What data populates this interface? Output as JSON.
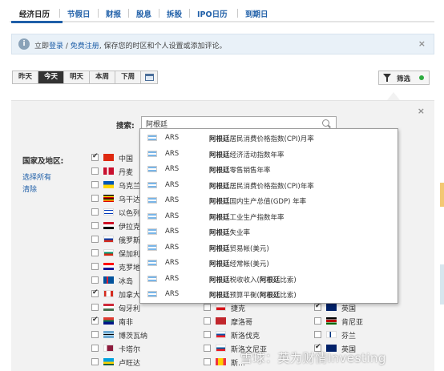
{
  "tabs": [
    {
      "label": "经济日历"
    },
    {
      "label": "节假日"
    },
    {
      "label": "财报"
    },
    {
      "label": "股息"
    },
    {
      "label": "拆股"
    },
    {
      "label": "IPO日历"
    },
    {
      "label": "到期日"
    }
  ],
  "banner": {
    "pre": "立即",
    "login": "登录",
    "sep": " / ",
    "register": "免费注册",
    "post": ", 保存您的时区和个人设置或添加评论。",
    "close": "×"
  },
  "date_buttons": [
    "昨天",
    "今天",
    "明天",
    "本周",
    "下周"
  ],
  "filter": {
    "label": "筛选"
  },
  "panel": {
    "close": "×",
    "search_label": "搜索:",
    "search_value": "阿根廷",
    "countries_label": "国家及地区:",
    "select_all": "选择所有",
    "clear": "清除"
  },
  "col1": [
    {
      "name": "中国",
      "checked": true
    },
    {
      "name": "丹麦",
      "checked": false
    },
    {
      "name": "乌克兰",
      "checked": false
    },
    {
      "name": "乌干达",
      "checked": false
    },
    {
      "name": "以色列",
      "checked": false
    },
    {
      "name": "伊拉克",
      "checked": false
    },
    {
      "name": "俄罗斯",
      "checked": false
    },
    {
      "name": "保加利",
      "checked": false
    },
    {
      "name": "克罗地",
      "checked": false
    },
    {
      "name": "冰岛",
      "checked": false
    },
    {
      "name": "加拿大",
      "checked": true
    },
    {
      "name": "匈牙利",
      "checked": false
    },
    {
      "name": "南非",
      "checked": true
    },
    {
      "name": "博茨瓦纳",
      "checked": false
    },
    {
      "name": "卡塔尔",
      "checked": false
    },
    {
      "name": "卢旺达",
      "checked": false
    }
  ],
  "col2": [
    {
      "name": "捷克",
      "checked": false
    },
    {
      "name": "摩洛哥",
      "checked": false
    },
    {
      "name": "斯洛伐克",
      "checked": false
    },
    {
      "name": "斯洛文尼亚",
      "checked": false
    },
    {
      "name": "斯…",
      "checked": false
    }
  ],
  "col3": [
    {
      "name": "英国",
      "checked": true
    },
    {
      "name": "肯尼亚",
      "checked": false
    },
    {
      "name": "芬兰",
      "checked": false
    },
    {
      "name": "英国",
      "checked": true
    }
  ],
  "dropdown": [
    {
      "code": "ARS",
      "bold": "阿根廷",
      "rest": "居民消费价格指数(CPI)月率",
      "bold2": "",
      "rest2": ""
    },
    {
      "code": "ARS",
      "bold": "阿根廷",
      "rest": "经济活动指数年率",
      "bold2": "",
      "rest2": ""
    },
    {
      "code": "ARS",
      "bold": "阿根廷",
      "rest": "零售销售年率",
      "bold2": "",
      "rest2": ""
    },
    {
      "code": "ARS",
      "bold": "阿根廷",
      "rest": "居民消费价格指数(CPI)年率",
      "bold2": "",
      "rest2": ""
    },
    {
      "code": "ARS",
      "bold": "阿根廷",
      "rest": "国内生产总值(GDP) 年率",
      "bold2": "",
      "rest2": ""
    },
    {
      "code": "ARS",
      "bold": "阿根廷",
      "rest": "工业生产指数年率",
      "bold2": "",
      "rest2": ""
    },
    {
      "code": "ARS",
      "bold": "阿根廷",
      "rest": "失业率",
      "bold2": "",
      "rest2": ""
    },
    {
      "code": "ARS",
      "bold": "阿根廷",
      "rest": "贸易帐(美元)",
      "bold2": "",
      "rest2": ""
    },
    {
      "code": "ARS",
      "bold": "阿根廷",
      "rest": "经常帐(美元)",
      "bold2": "",
      "rest2": ""
    },
    {
      "code": "ARS",
      "bold": "阿根廷",
      "rest": "税收收入(",
      "bold2": "阿根廷",
      "rest2": "比索)"
    },
    {
      "code": "ARS",
      "bold": "阿根廷",
      "rest": "预算平衡(",
      "bold2": "阿根廷",
      "rest2": "比索)"
    }
  ],
  "watermark": "雪球：英为财情Investing",
  "colors": {
    "accent": "#1f5fa8",
    "filter_dot": "#2cab3f",
    "active_btn": "#333333"
  }
}
